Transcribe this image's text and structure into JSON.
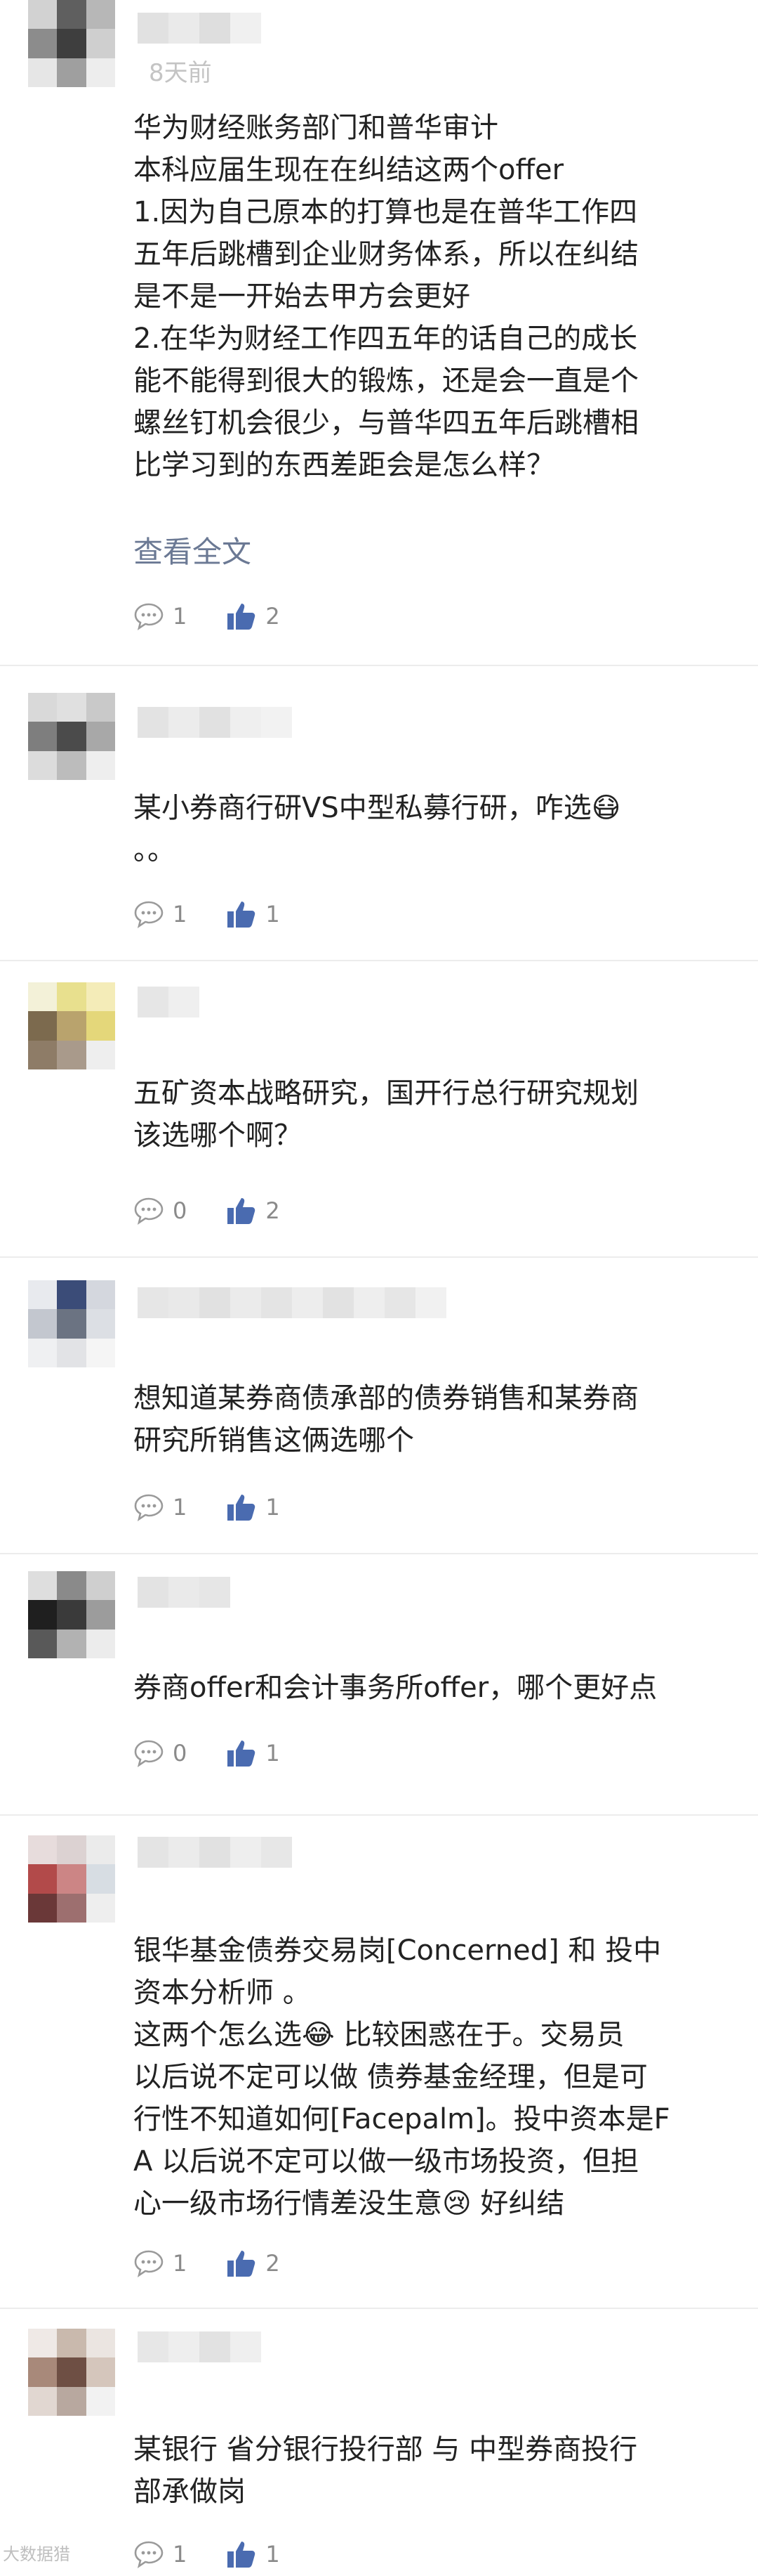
{
  "posts": [
    {
      "time": "8天前",
      "lines": [
        "华为财经账务部门和普华审计",
        "",
        "本科应届生现在在纠结这两个offer",
        "1.因为自己原本的打算也是在普华工作四",
        "五年后跳槽到企业财务体系，所以在纠结",
        "是不是一开始去甲方会更好",
        "2.在华为财经工作四五年的话自己的成长",
        "能不能得到很大的锻炼，还是会一直是个",
        "螺丝钉机会很少，与普华四五年后跳槽相",
        "比学习到的东西差距会是怎么样？"
      ],
      "more_label": "查看全文",
      "comment_count": "1",
      "like_count": "2"
    },
    {
      "lines": [
        "某小券商行研VS中型私募行研，咋选😷",
        "。。"
      ],
      "comment_count": "1",
      "like_count": "1"
    },
    {
      "lines": [
        "五矿资本战略研究，国开行总行研究规划",
        "该选哪个啊？"
      ],
      "comment_count": "0",
      "like_count": "2"
    },
    {
      "lines": [
        "想知道某券商债承部的债券销售和某券商",
        "研究所销售这俩选哪个"
      ],
      "comment_count": "1",
      "like_count": "1"
    },
    {
      "lines": [
        "券商offer和会计事务所offer，哪个更好点"
      ],
      "comment_count": "0",
      "like_count": "1"
    },
    {
      "lines": [
        "银华基金债券交易岗[Concerned] 和 投中",
        "资本分析师 。",
        "这两个怎么选😂 比较困惑在于。交易员",
        "以后说不定可以做 债券基金经理，但是可",
        "行性不知道如何[Facepalm]。投中资本是F",
        "A 以后说不定可以做一级市场投资，但担",
        "心一级市场行情差没生意😢 好纠结"
      ],
      "comment_count": "1",
      "like_count": "2"
    },
    {
      "lines": [
        "某银行 省分银行投行部 与 中型券商投行",
        "部承做岗"
      ],
      "comment_count": "1",
      "like_count": "1"
    }
  ],
  "footer_watermark": "大数据猎",
  "icons": {
    "comment": "comment-bubble-icon",
    "like": "thumbs-up-icon"
  },
  "colors": {
    "text": "#222222",
    "muted": "#8a8a8a",
    "link": "#6b7994",
    "like_icon": "#4a6bb0",
    "divider": "#ececec"
  }
}
